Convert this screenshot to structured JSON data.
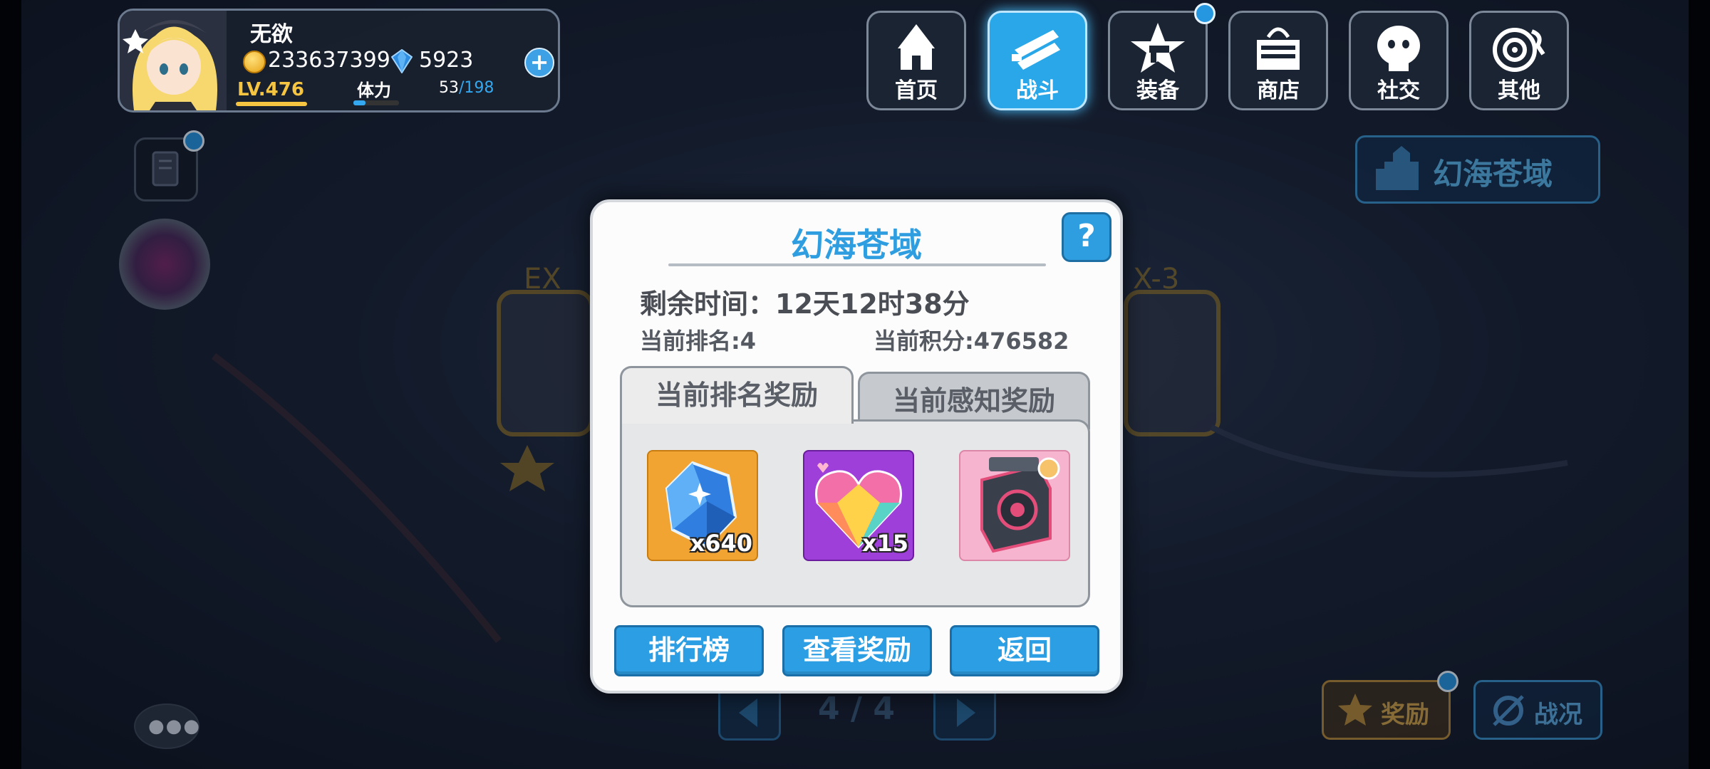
{
  "player": {
    "name": "无欲",
    "coins": "233637399",
    "gems": "5923",
    "level": "LV.476",
    "stamina_label": "体力",
    "stamina_current": "53",
    "stamina_max": "/198",
    "stamina_fraction": 0.27
  },
  "nav": {
    "items": [
      {
        "label": "首页",
        "icon": "home-house-icon"
      },
      {
        "label": "战斗",
        "icon": "battle-swords-icon",
        "active": true
      },
      {
        "label": "装备",
        "icon": "equipment-star-gun-icon",
        "badge": true
      },
      {
        "label": "商店",
        "icon": "shop-basket-icon"
      },
      {
        "label": "社交",
        "icon": "social-ghost-icon"
      },
      {
        "label": "其他",
        "icon": "other-target-icon"
      }
    ]
  },
  "background": {
    "area_title": "幻海苍域",
    "reward_label": "奖励",
    "status_label": "战况",
    "pager": "4 / 4"
  },
  "dialog": {
    "title": "幻海苍域",
    "help": "?",
    "remaining_time": "剩余时间：12天12时38分",
    "current_rank": "当前排名:4",
    "current_score": "当前积分:476582",
    "tabs": [
      "当前排名奖励",
      "当前感知奖励"
    ],
    "rewards": [
      {
        "icon": "blue-crystal-icon",
        "qty": "x640"
      },
      {
        "icon": "rainbow-heart-gem-icon",
        "qty": "x15"
      },
      {
        "icon": "pink-machine-device-icon",
        "qty": ""
      }
    ],
    "buttons": {
      "leaderboard": "排行榜",
      "view_rewards": "查看奖励",
      "back": "返回"
    }
  },
  "colors": {
    "accent": "#2f9ee0",
    "gold": "#f5c542"
  }
}
